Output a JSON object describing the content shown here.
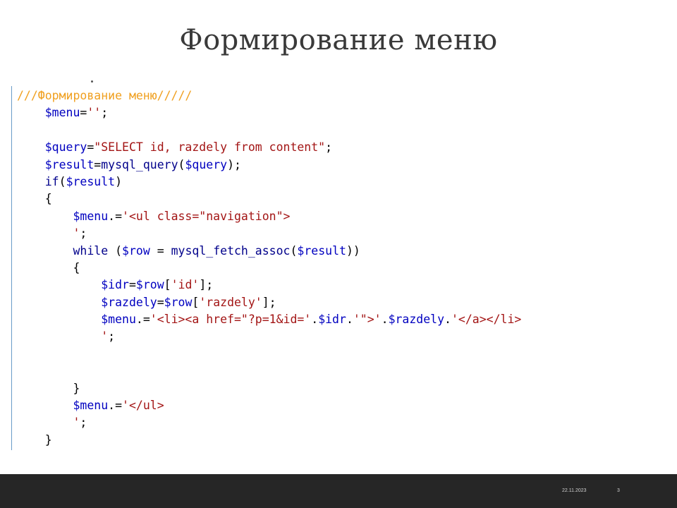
{
  "title": "Формирование меню",
  "code": {
    "lines": [
      [
        {
          "t": "///Формирование меню/////",
          "c": "comment"
        }
      ],
      [
        {
          "t": "    ",
          "c": "op"
        },
        {
          "t": "$menu",
          "c": "var"
        },
        {
          "t": "=",
          "c": "op"
        },
        {
          "t": "''",
          "c": "str"
        },
        {
          "t": ";",
          "c": "op"
        }
      ],
      [],
      [
        {
          "t": "    ",
          "c": "op"
        },
        {
          "t": "$query",
          "c": "var"
        },
        {
          "t": "=",
          "c": "op"
        },
        {
          "t": "\"SELECT id, razdely from content\"",
          "c": "str"
        },
        {
          "t": ";",
          "c": "op"
        }
      ],
      [
        {
          "t": "    ",
          "c": "op"
        },
        {
          "t": "$result",
          "c": "var"
        },
        {
          "t": "=",
          "c": "op"
        },
        {
          "t": "mysql_query",
          "c": "fn"
        },
        {
          "t": "(",
          "c": "op"
        },
        {
          "t": "$query",
          "c": "var"
        },
        {
          "t": ");",
          "c": "op"
        }
      ],
      [
        {
          "t": "    ",
          "c": "op"
        },
        {
          "t": "if",
          "c": "kw"
        },
        {
          "t": "(",
          "c": "op"
        },
        {
          "t": "$result",
          "c": "var"
        },
        {
          "t": ")",
          "c": "op"
        }
      ],
      [
        {
          "t": "    {",
          "c": "op"
        }
      ],
      [
        {
          "t": "        ",
          "c": "op"
        },
        {
          "t": "$menu",
          "c": "var"
        },
        {
          "t": ".=",
          "c": "op"
        },
        {
          "t": "'<ul class=\"navigation\">",
          "c": "str"
        }
      ],
      [
        {
          "t": "        ",
          "c": "op"
        },
        {
          "t": "'",
          "c": "str"
        },
        {
          "t": ";",
          "c": "op"
        }
      ],
      [
        {
          "t": "        ",
          "c": "op"
        },
        {
          "t": "while",
          "c": "kw"
        },
        {
          "t": " (",
          "c": "op"
        },
        {
          "t": "$row",
          "c": "var"
        },
        {
          "t": " = ",
          "c": "op"
        },
        {
          "t": "mysql_fetch_assoc",
          "c": "fn"
        },
        {
          "t": "(",
          "c": "op"
        },
        {
          "t": "$result",
          "c": "var"
        },
        {
          "t": "))",
          "c": "op"
        }
      ],
      [
        {
          "t": "        {",
          "c": "op"
        }
      ],
      [
        {
          "t": "            ",
          "c": "op"
        },
        {
          "t": "$idr",
          "c": "var"
        },
        {
          "t": "=",
          "c": "op"
        },
        {
          "t": "$row",
          "c": "var"
        },
        {
          "t": "[",
          "c": "op"
        },
        {
          "t": "'id'",
          "c": "str"
        },
        {
          "t": "];",
          "c": "op"
        }
      ],
      [
        {
          "t": "            ",
          "c": "op"
        },
        {
          "t": "$razdely",
          "c": "var"
        },
        {
          "t": "=",
          "c": "op"
        },
        {
          "t": "$row",
          "c": "var"
        },
        {
          "t": "[",
          "c": "op"
        },
        {
          "t": "'razdely'",
          "c": "str"
        },
        {
          "t": "];",
          "c": "op"
        }
      ],
      [
        {
          "t": "            ",
          "c": "op"
        },
        {
          "t": "$menu",
          "c": "var"
        },
        {
          "t": ".=",
          "c": "op"
        },
        {
          "t": "'<li><a href=\"?p=1&id='",
          "c": "str"
        },
        {
          "t": ".",
          "c": "op"
        },
        {
          "t": "$idr",
          "c": "var"
        },
        {
          "t": ".",
          "c": "op"
        },
        {
          "t": "'\">'",
          "c": "str"
        },
        {
          "t": ".",
          "c": "op"
        },
        {
          "t": "$razdely",
          "c": "var"
        },
        {
          "t": ".",
          "c": "op"
        },
        {
          "t": "'</a></li>",
          "c": "str"
        }
      ],
      [
        {
          "t": "            ",
          "c": "op"
        },
        {
          "t": "'",
          "c": "str"
        },
        {
          "t": ";",
          "c": "op"
        }
      ],
      [],
      [],
      [
        {
          "t": "        }",
          "c": "op"
        }
      ],
      [
        {
          "t": "        ",
          "c": "op"
        },
        {
          "t": "$menu",
          "c": "var"
        },
        {
          "t": ".=",
          "c": "op"
        },
        {
          "t": "'</ul>",
          "c": "str"
        }
      ],
      [
        {
          "t": "        ",
          "c": "op"
        },
        {
          "t": "'",
          "c": "str"
        },
        {
          "t": ";",
          "c": "op"
        }
      ],
      [
        {
          "t": "    }",
          "c": "op"
        }
      ]
    ]
  },
  "footer": {
    "date": "22.11.2023",
    "page": "3"
  }
}
